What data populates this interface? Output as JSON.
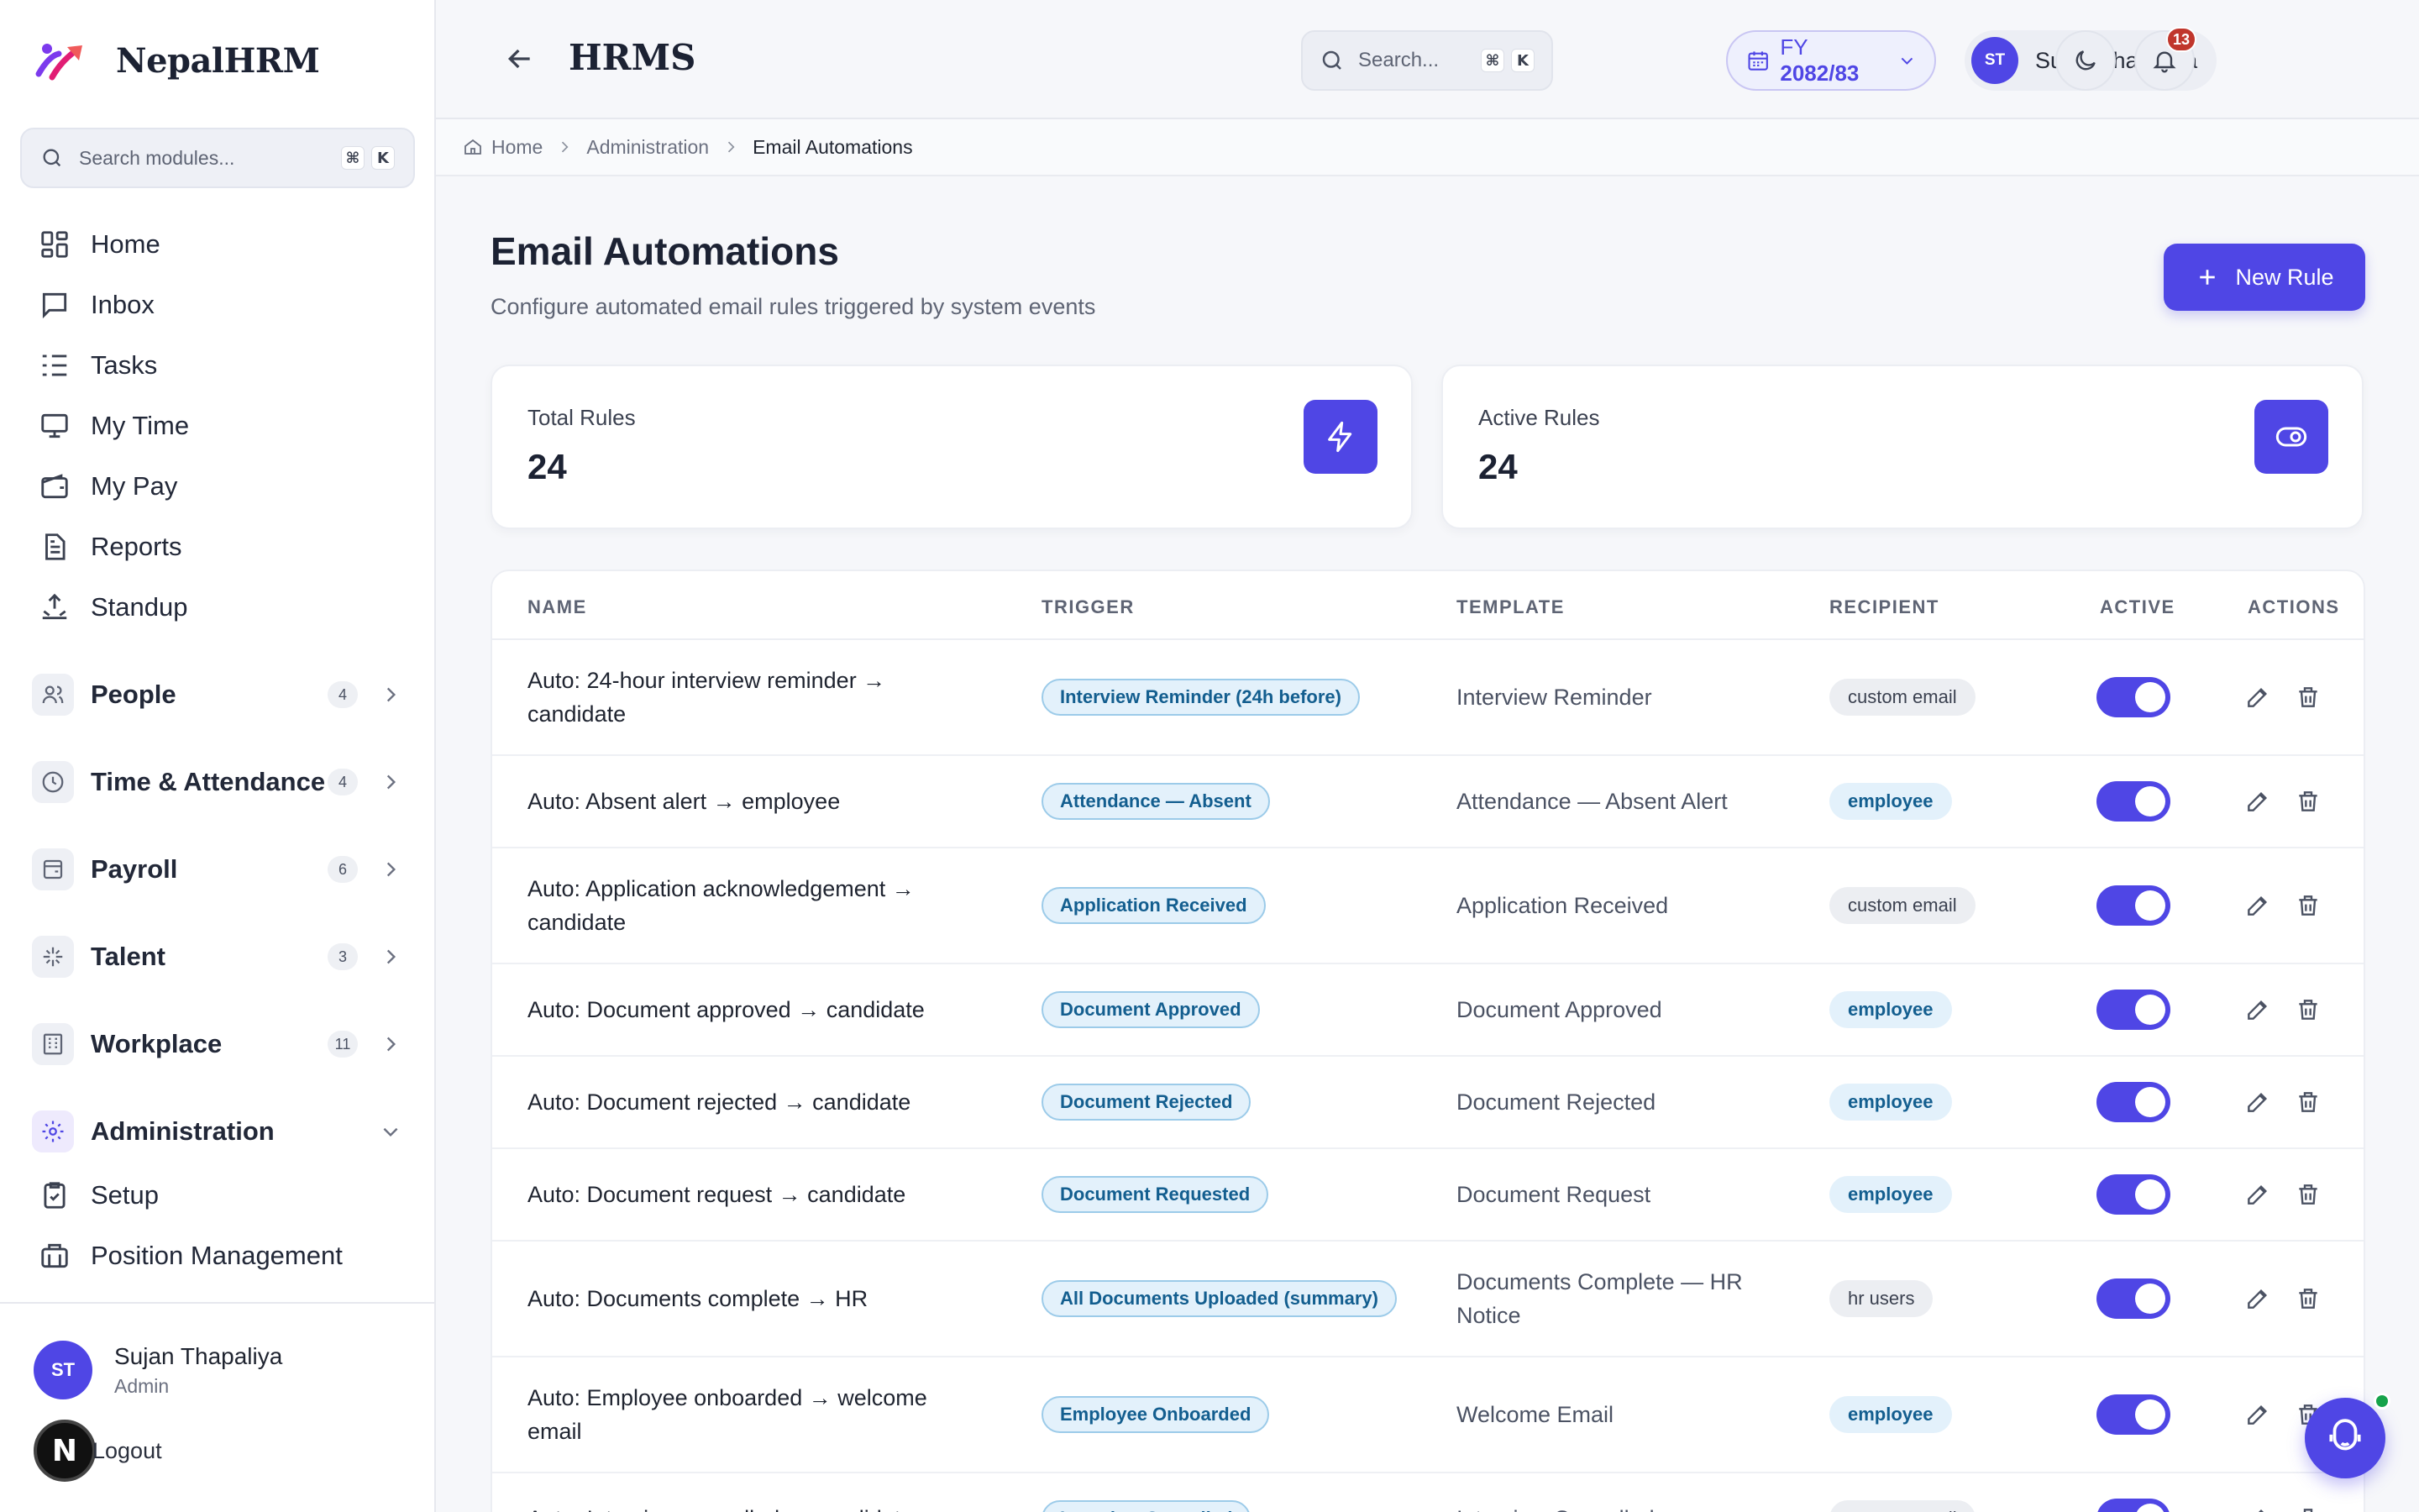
{
  "brand": {
    "name": "NepalHRM"
  },
  "sidebar": {
    "search_placeholder": "Search modules...",
    "kbd": [
      "⌘",
      "K"
    ],
    "main_items": [
      {
        "label": "Home",
        "icon": "dashboard-icon"
      },
      {
        "label": "Inbox",
        "icon": "chat-icon"
      },
      {
        "label": "Tasks",
        "icon": "task-list-icon"
      },
      {
        "label": "My Time",
        "icon": "monitor-icon"
      },
      {
        "label": "My Pay",
        "icon": "wallet-icon"
      },
      {
        "label": "Reports",
        "icon": "document-icon"
      },
      {
        "label": "Standup",
        "icon": "standup-icon"
      }
    ],
    "groups": [
      {
        "label": "People",
        "count": "4",
        "icon": "people-icon"
      },
      {
        "label": "Time & Attendance",
        "count": "4",
        "icon": "clock-icon"
      },
      {
        "label": "Payroll",
        "count": "6",
        "icon": "payroll-icon"
      },
      {
        "label": "Talent",
        "count": "3",
        "icon": "sparkle-icon"
      },
      {
        "label": "Workplace",
        "count": "11",
        "icon": "building-icon"
      }
    ],
    "admin": {
      "label": "Administration",
      "icon": "gear-icon",
      "children": [
        {
          "label": "Setup",
          "icon": "clipboard-check-icon"
        },
        {
          "label": "Position Management",
          "icon": "briefcase-icon"
        }
      ]
    },
    "user": {
      "initials": "ST",
      "name": "Sujan Thapaliya",
      "role": "Admin"
    },
    "logout": {
      "badge": "N",
      "label": "Logout"
    }
  },
  "header": {
    "title": "HRMS",
    "search_placeholder": "Search...",
    "kbd": [
      "⌘",
      "K"
    ],
    "fy": {
      "prefix": "FY ",
      "value": "2082/83"
    },
    "user": {
      "initials": "ST",
      "name": "Sujan Thapaliya"
    },
    "notifications": "13"
  },
  "breadcrumb": [
    "Home",
    "Administration",
    "Email Automations"
  ],
  "page": {
    "title": "Email Automations",
    "subtitle": "Configure automated email rules triggered by system events",
    "new_button": "New Rule"
  },
  "stats": [
    {
      "label": "Total Rules",
      "value": "24",
      "icon": "lightning-icon"
    },
    {
      "label": "Active Rules",
      "value": "24",
      "icon": "toggle-eye-icon"
    }
  ],
  "table": {
    "columns": [
      "NAME",
      "TRIGGER",
      "TEMPLATE",
      "RECIPIENT",
      "ACTIVE",
      "ACTIONS"
    ],
    "rows": [
      {
        "name": "Auto: 24-hour interview reminder → candidate",
        "trigger": "Interview Reminder (24h before)",
        "template": "Interview Reminder",
        "recipient": "custom email",
        "active": true
      },
      {
        "name": "Auto: Absent alert → employee",
        "trigger": "Attendance — Absent",
        "template": "Attendance — Absent Alert",
        "recipient": "employee",
        "active": true
      },
      {
        "name": "Auto: Application acknowledgement → candidate",
        "trigger": "Application Received",
        "template": "Application Received",
        "recipient": "custom email",
        "active": true
      },
      {
        "name": "Auto: Document approved → candidate",
        "trigger": "Document Approved",
        "template": "Document Approved",
        "recipient": "employee",
        "active": true
      },
      {
        "name": "Auto: Document rejected → candidate",
        "trigger": "Document Rejected",
        "template": "Document Rejected",
        "recipient": "employee",
        "active": true
      },
      {
        "name": "Auto: Document request → candidate",
        "trigger": "Document Requested",
        "template": "Document Request",
        "recipient": "employee",
        "active": true
      },
      {
        "name": "Auto: Documents complete → HR",
        "trigger": "All Documents Uploaded (summary)",
        "template": "Documents Complete — HR Notice",
        "recipient": "hr users",
        "active": true
      },
      {
        "name": "Auto: Employee onboarded → welcome email",
        "trigger": "Employee Onboarded",
        "template": "Welcome Email",
        "recipient": "employee",
        "active": true
      },
      {
        "name": "Auto: Interview cancelled → candidate",
        "trigger": "Interview Cancelled",
        "template": "Interview Cancelled",
        "recipient": "custom email",
        "active": true
      }
    ]
  },
  "colors": {
    "accent": "#4f46e5",
    "trigger_bg": "#e3f1fb",
    "trigger_text": "#135e8f",
    "notif": "#c0362c"
  }
}
